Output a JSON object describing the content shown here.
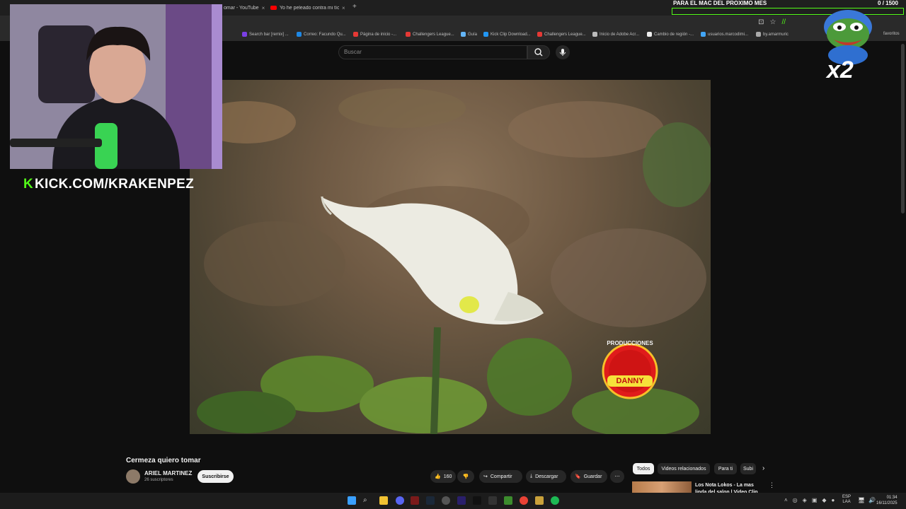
{
  "browser": {
    "tabs": [
      {
        "label": "omar - YouTube"
      },
      {
        "label": "Yo he peleado contra mi tío - YouTube"
      }
    ],
    "bookmarks": [
      "Search bar [remix] ...",
      "Correo: Facundo Qu...",
      "Página de inicio -...",
      "Challengers League...",
      "Guía",
      "Kick Clip Download...",
      "Challengers League...",
      "Inicio de Adobe Acr...",
      "Cambio de región -...",
      "usuarios.marcodimi...",
      "by.amarmuric"
    ],
    "bookmarks_overflow": "favoritos"
  },
  "youtube": {
    "search_placeholder": "Buscar",
    "video_title": "Cermeza quiero tomar",
    "channel_name": "ARIEL MARTINEZ",
    "channel_subs": "26 suscriptores",
    "subscribe_label": "Suscribirse",
    "likes": "160",
    "share_label": "Compartir",
    "download_label": "Descargar",
    "save_label": "Guardar",
    "chips": [
      "Todos",
      "Videos relacionados",
      "Para ti",
      "Subi"
    ],
    "related": [
      {
        "title": "Los Nota Lokos - La mas linda del salon | Video Clip Oficial"
      }
    ],
    "watermark_top": "PRODUCCIONES",
    "watermark_name": "DANNY"
  },
  "stream_overlay": {
    "kick_url": "KICK.COM/KRAKENPEZ",
    "goal_label": "PARA EL MAC DEL PROXIMO MES",
    "goal_current": "0",
    "goal_target": "/ 1500",
    "goal_progress": 0,
    "emote_text": "x2"
  },
  "taskbar": {
    "lang_top": "ESP",
    "lang_bottom": "LAA",
    "time": "01:34",
    "date": "16/11/2025"
  },
  "colors": {
    "kick_green": "#53fc18",
    "youtube_red": "#ff0000",
    "bg": "#0f0f0f"
  }
}
